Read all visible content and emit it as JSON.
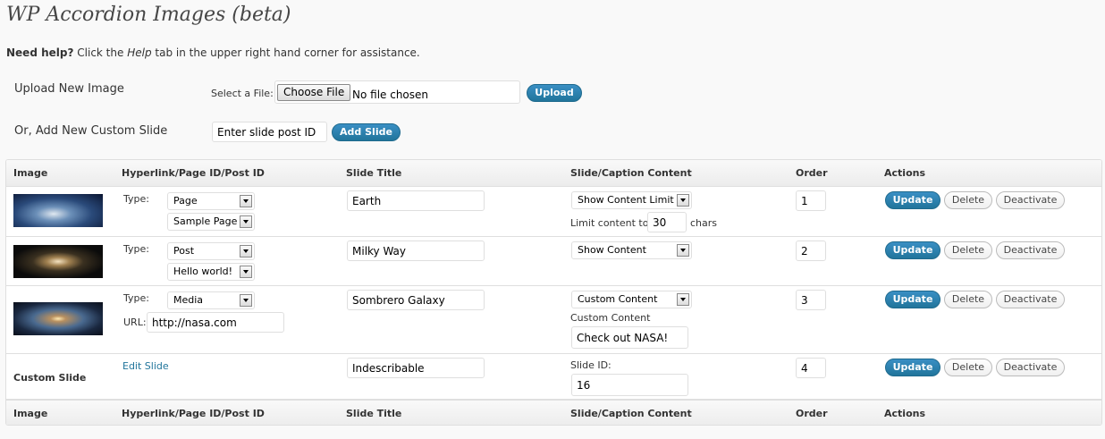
{
  "page": {
    "title": "WP Accordion Images (beta)",
    "help_bold": "Need help?",
    "help_pre": "Click the",
    "help_tab": "Help",
    "help_post": "tab in the upper right hand corner for assistance."
  },
  "upload": {
    "label": "Upload New Image",
    "select_file_label": "Select a File:",
    "choose_file_button": "Choose File",
    "no_file_text": "No file chosen",
    "upload_button": "Upload"
  },
  "custom_slide": {
    "label": "Or, Add New Custom Slide",
    "input_value": "Enter slide post ID",
    "add_button": "Add Slide"
  },
  "table": {
    "columns": [
      "Image",
      "Hyperlink/Page ID/Post ID",
      "Slide Title",
      "Slide/Caption Content",
      "Order",
      "Actions"
    ],
    "type_label": "Type:",
    "url_label": "URL:",
    "limit_prefix": "Limit content to",
    "limit_suffix": "chars",
    "custom_content_label": "Custom Content",
    "slide_id_label": "Slide ID:",
    "edit_slide_link": "Edit Slide",
    "custom_slide_label": "Custom Slide",
    "update_label": "Update",
    "delete_label": "Delete",
    "deactivate_label": "Deactivate",
    "rows": [
      {
        "image": "earth-thumbnail",
        "type": "Page",
        "link_select": "Sample Page",
        "title": "Earth",
        "content_mode": "Show Content Limit",
        "limit_value": "30",
        "order": "1"
      },
      {
        "image": "milky-way-thumbnail",
        "type": "Post",
        "link_select": "Hello world!",
        "title": "Milky Way",
        "content_mode": "Show Content",
        "order": "2"
      },
      {
        "image": "sombrero-galaxy-thumbnail",
        "type": "Media",
        "url": "http://nasa.com",
        "title": "Sombrero Galaxy",
        "content_mode": "Custom Content",
        "custom_content": "Check out NASA!",
        "order": "3"
      },
      {
        "title": "Indescribable",
        "slide_id": "16",
        "order": "4"
      }
    ]
  }
}
